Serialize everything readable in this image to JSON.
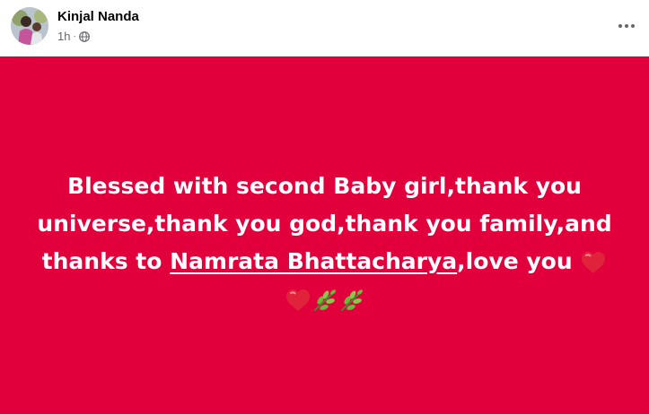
{
  "post": {
    "author_name": "Kinjal Nanda",
    "time": "1h",
    "meta_separator": "·",
    "audience_icon": "globe-icon",
    "more_icon": "more-options-icon",
    "background_color": "#e1003c",
    "text_color": "#ffffff",
    "message": {
      "text_before_mention": "Blessed with second Baby girl,thank you universe,thank you god,thank you family,and thanks to ",
      "mention": "Namrata Bhattacharya",
      "text_after_mention": ",love you ",
      "trailing_icons": [
        "red-heart-icon",
        "red-heart-icon",
        "herb-icon",
        "herb-icon"
      ]
    }
  }
}
